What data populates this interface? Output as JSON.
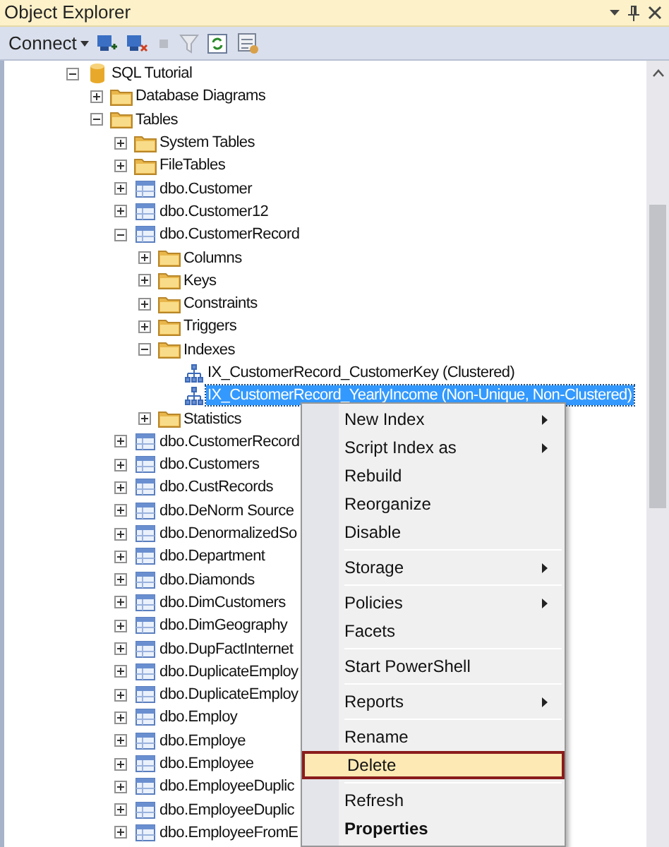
{
  "window": {
    "title": "Object Explorer"
  },
  "toolbar": {
    "connect": "Connect"
  },
  "tree": [
    {
      "label": "SQL Tutorial",
      "kind": "database",
      "expanded": true,
      "selected": false,
      "children": [
        {
          "label": "Database Diagrams",
          "kind": "folder",
          "expanded": false,
          "selected": false
        },
        {
          "label": "Tables",
          "kind": "folder",
          "expanded": true,
          "selected": false,
          "children": [
            {
              "label": "System Tables",
              "kind": "folder",
              "expanded": false,
              "selected": false
            },
            {
              "label": "FileTables",
              "kind": "folder",
              "expanded": false,
              "selected": false
            },
            {
              "label": "dbo.Customer",
              "kind": "table",
              "expanded": false,
              "selected": false
            },
            {
              "label": "dbo.Customer12",
              "kind": "table",
              "expanded": false,
              "selected": false
            },
            {
              "label": "dbo.CustomerRecord",
              "kind": "table",
              "expanded": true,
              "selected": false,
              "children": [
                {
                  "label": "Columns",
                  "kind": "folder",
                  "expanded": false,
                  "selected": false
                },
                {
                  "label": "Keys",
                  "kind": "folder",
                  "expanded": false,
                  "selected": false
                },
                {
                  "label": "Constraints",
                  "kind": "folder",
                  "expanded": false,
                  "selected": false
                },
                {
                  "label": "Triggers",
                  "kind": "folder",
                  "expanded": false,
                  "selected": false
                },
                {
                  "label": "Indexes",
                  "kind": "folder",
                  "expanded": true,
                  "selected": false,
                  "children": [
                    {
                      "label": "IX_CustomerRecord_CustomerKey (Clustered)",
                      "kind": "index",
                      "selected": false
                    },
                    {
                      "label": "IX_CustomerRecord_YearlyIncome (Non-Unique, Non-Clustered)",
                      "kind": "index",
                      "selected": true
                    }
                  ]
                },
                {
                  "label": "Statistics",
                  "kind": "folder",
                  "expanded": false,
                  "selected": false
                }
              ]
            },
            {
              "label": "dbo.CustomerRecord",
              "kind": "table",
              "expanded": false,
              "selected": false
            },
            {
              "label": "dbo.Customers",
              "kind": "table",
              "expanded": false,
              "selected": false
            },
            {
              "label": "dbo.CustRecords",
              "kind": "table",
              "expanded": false,
              "selected": false
            },
            {
              "label": "dbo.DeNorm Source",
              "kind": "table",
              "expanded": false,
              "selected": false
            },
            {
              "label": "dbo.DenormalizedSo",
              "kind": "table",
              "expanded": false,
              "selected": false
            },
            {
              "label": "dbo.Department",
              "kind": "table",
              "expanded": false,
              "selected": false
            },
            {
              "label": "dbo.Diamonds",
              "kind": "table",
              "expanded": false,
              "selected": false
            },
            {
              "label": "dbo.DimCustomers",
              "kind": "table",
              "expanded": false,
              "selected": false
            },
            {
              "label": "dbo.DimGeography",
              "kind": "table",
              "expanded": false,
              "selected": false
            },
            {
              "label": "dbo.DupFactInternet",
              "kind": "table",
              "expanded": false,
              "selected": false
            },
            {
              "label": "dbo.DuplicateEmploy",
              "kind": "table",
              "expanded": false,
              "selected": false
            },
            {
              "label": "dbo.DuplicateEmploy",
              "kind": "table",
              "expanded": false,
              "selected": false
            },
            {
              "label": "dbo.Employ",
              "kind": "table",
              "expanded": false,
              "selected": false
            },
            {
              "label": "dbo.Employe",
              "kind": "table",
              "expanded": false,
              "selected": false
            },
            {
              "label": "dbo.Employee",
              "kind": "table",
              "expanded": false,
              "selected": false
            },
            {
              "label": "dbo.EmployeeDuplic",
              "kind": "table",
              "expanded": false,
              "selected": false
            },
            {
              "label": "dbo.EmployeeDuplic",
              "kind": "table",
              "expanded": false,
              "selected": false
            },
            {
              "label": "dbo.EmployeeFromE",
              "kind": "table",
              "expanded": false,
              "selected": false
            }
          ]
        }
      ]
    }
  ],
  "context_menu": [
    {
      "kind": "item",
      "label": "New Index",
      "submenu": true,
      "highlighted": false,
      "bold": false
    },
    {
      "kind": "item",
      "label": "Script Index as",
      "submenu": true,
      "highlighted": false,
      "bold": false
    },
    {
      "kind": "item",
      "label": "Rebuild",
      "submenu": false,
      "highlighted": false,
      "bold": false
    },
    {
      "kind": "item",
      "label": "Reorganize",
      "submenu": false,
      "highlighted": false,
      "bold": false
    },
    {
      "kind": "item",
      "label": "Disable",
      "submenu": false,
      "highlighted": false,
      "bold": false
    },
    {
      "kind": "separator"
    },
    {
      "kind": "item",
      "label": "Storage",
      "submenu": true,
      "highlighted": false,
      "bold": false
    },
    {
      "kind": "separator"
    },
    {
      "kind": "item",
      "label": "Policies",
      "submenu": true,
      "highlighted": false,
      "bold": false
    },
    {
      "kind": "item",
      "label": "Facets",
      "submenu": false,
      "highlighted": false,
      "bold": false
    },
    {
      "kind": "separator"
    },
    {
      "kind": "item",
      "label": "Start PowerShell",
      "submenu": false,
      "highlighted": false,
      "bold": false
    },
    {
      "kind": "separator"
    },
    {
      "kind": "item",
      "label": "Reports",
      "submenu": true,
      "highlighted": false,
      "bold": false
    },
    {
      "kind": "separator"
    },
    {
      "kind": "item",
      "label": "Rename",
      "submenu": false,
      "highlighted": false,
      "bold": false
    },
    {
      "kind": "item",
      "label": "Delete",
      "submenu": false,
      "highlighted": true,
      "bold": false
    },
    {
      "kind": "separator"
    },
    {
      "kind": "item",
      "label": "Refresh",
      "submenu": false,
      "highlighted": false,
      "bold": false
    },
    {
      "kind": "item",
      "label": "Properties",
      "submenu": false,
      "highlighted": false,
      "bold": true
    }
  ]
}
